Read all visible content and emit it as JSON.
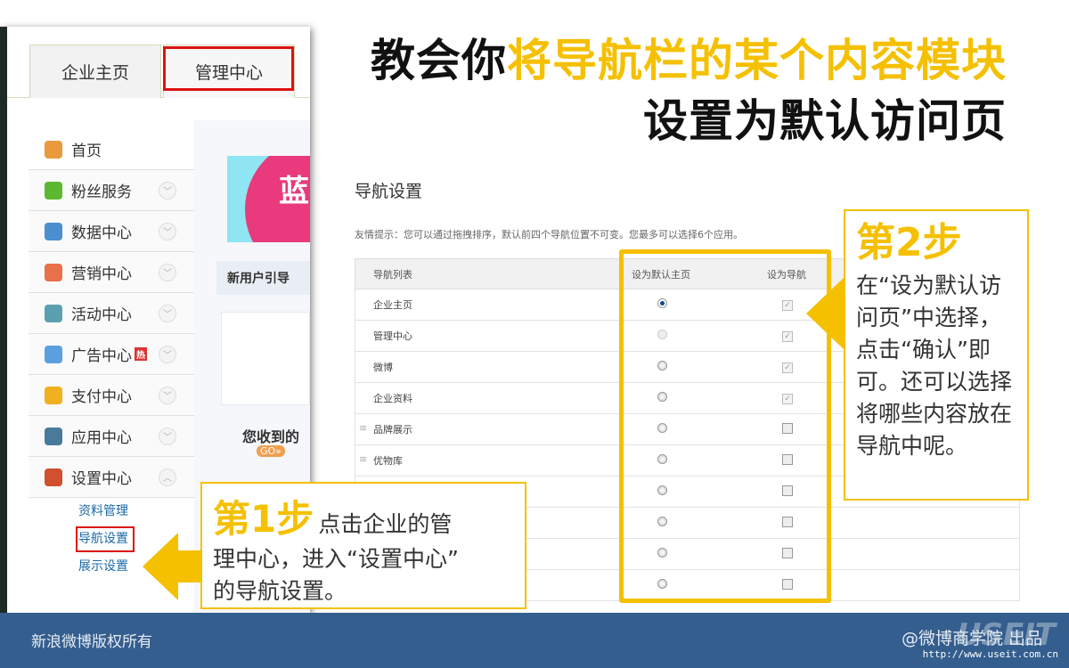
{
  "title": {
    "line1_black": "教会你",
    "line1_yellow": "将导航栏的某个内容模块",
    "line2": "设置为默认访问页"
  },
  "app": {
    "tabs": [
      "企业主页",
      "管理中心"
    ],
    "sidebar": [
      {
        "label": "首页",
        "icon": "home-icon",
        "color": "#e89a3c"
      },
      {
        "label": "粉丝服务",
        "icon": "fans-icon",
        "color": "#5cb82e"
      },
      {
        "label": "数据中心",
        "icon": "chart-icon",
        "color": "#4a8fd0"
      },
      {
        "label": "营销中心",
        "icon": "bag-icon",
        "color": "#e8704a"
      },
      {
        "label": "活动中心",
        "icon": "flag-icon",
        "color": "#5aa0b0"
      },
      {
        "label": "广告中心",
        "icon": "ad-icon",
        "color": "#5aa0e0",
        "badge": "热"
      },
      {
        "label": "支付中心",
        "icon": "yen-icon",
        "color": "#f0b020"
      },
      {
        "label": "应用中心",
        "icon": "puzzle-icon",
        "color": "#4a7a9a"
      },
      {
        "label": "设置中心",
        "icon": "toolbox-icon",
        "color": "#d05030"
      }
    ],
    "submenu": [
      "资料管理",
      "导航设置",
      "展示设置"
    ],
    "banner_text": "蓝",
    "guide": "新用户引导",
    "received": "您收到的",
    "go": "GO»"
  },
  "nav": {
    "title": "导航设置",
    "tip": "友情提示：您可以通过拖拽排序，默认前四个导航位置不可变。您最多可以选择6个应用。",
    "headers": [
      "导航列表",
      "设为默认主页",
      "设为导航"
    ],
    "rows": [
      {
        "name": "企业主页",
        "radio": "on",
        "check": "on",
        "drag": false
      },
      {
        "name": "管理中心",
        "radio": "dis",
        "check": "on",
        "drag": false
      },
      {
        "name": "微博",
        "radio": "off",
        "check": "on",
        "drag": false
      },
      {
        "name": "企业资料",
        "radio": "off",
        "check": "on",
        "drag": false
      },
      {
        "name": "品牌展示",
        "radio": "off",
        "check": "off",
        "drag": true
      },
      {
        "name": "优物库",
        "radio": "off",
        "check": "off",
        "drag": true
      },
      {
        "name": "",
        "radio": "off",
        "check": "off",
        "drag": false
      },
      {
        "name": "",
        "radio": "off",
        "check": "off",
        "drag": false
      },
      {
        "name": "",
        "radio": "off",
        "check": "off",
        "drag": false
      },
      {
        "name": "",
        "radio": "off",
        "check": "off",
        "drag": false
      }
    ]
  },
  "step1": {
    "label": "第1步",
    "text_a": "点击企业的管",
    "text_b": "理中心，进入“设置中心”",
    "text_c": "的导航设置。"
  },
  "step2": {
    "label": "第2步",
    "text": "在“设为默认访问页”中选择，点击“确认”即可。还可以选择将哪些内容放在导航中呢。"
  },
  "footer": {
    "copyright": "新浪微博版权所有",
    "producer": "@微博商学院 出品",
    "watermark": "USEIT",
    "url": "http://www.useit.com.cn"
  }
}
